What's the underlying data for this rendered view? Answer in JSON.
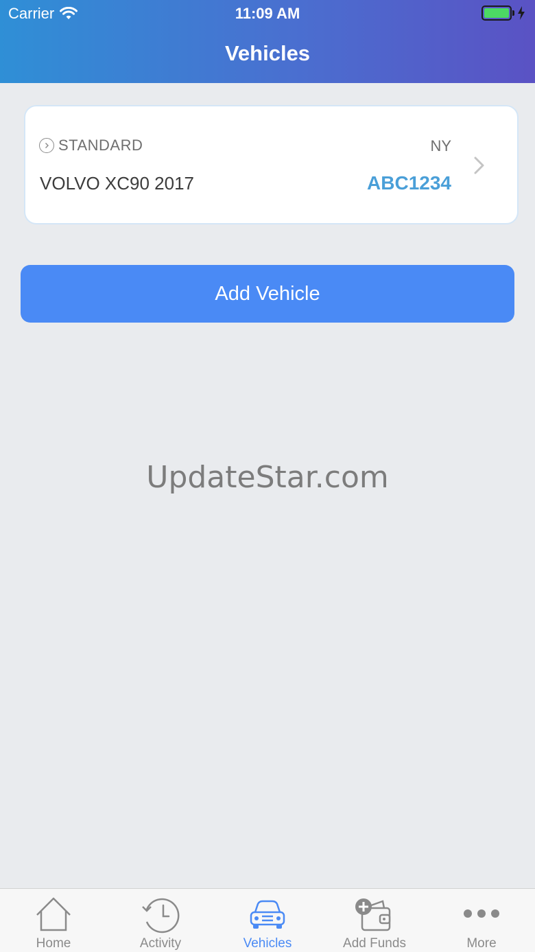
{
  "status_bar": {
    "carrier": "Carrier",
    "time": "11:09 AM"
  },
  "header": {
    "title": "Vehicles"
  },
  "vehicle": {
    "plan": "STANDARD",
    "state": "NY",
    "name": "VOLVO XC90 2017",
    "plate": "ABC1234"
  },
  "actions": {
    "add_vehicle": "Add Vehicle"
  },
  "watermark": "UpdateStar.com",
  "tabs": [
    {
      "label": "Home",
      "icon": "home-icon"
    },
    {
      "label": "Activity",
      "icon": "clock-history-icon"
    },
    {
      "label": "Vehicles",
      "icon": "car-icon",
      "active": true
    },
    {
      "label": "Add Funds",
      "icon": "wallet-add-icon"
    },
    {
      "label": "More",
      "icon": "more-dots-icon"
    }
  ],
  "colors": {
    "accent": "#4a8af5",
    "plate": "#4a9fd8",
    "inactive": "#8a8a8a"
  }
}
